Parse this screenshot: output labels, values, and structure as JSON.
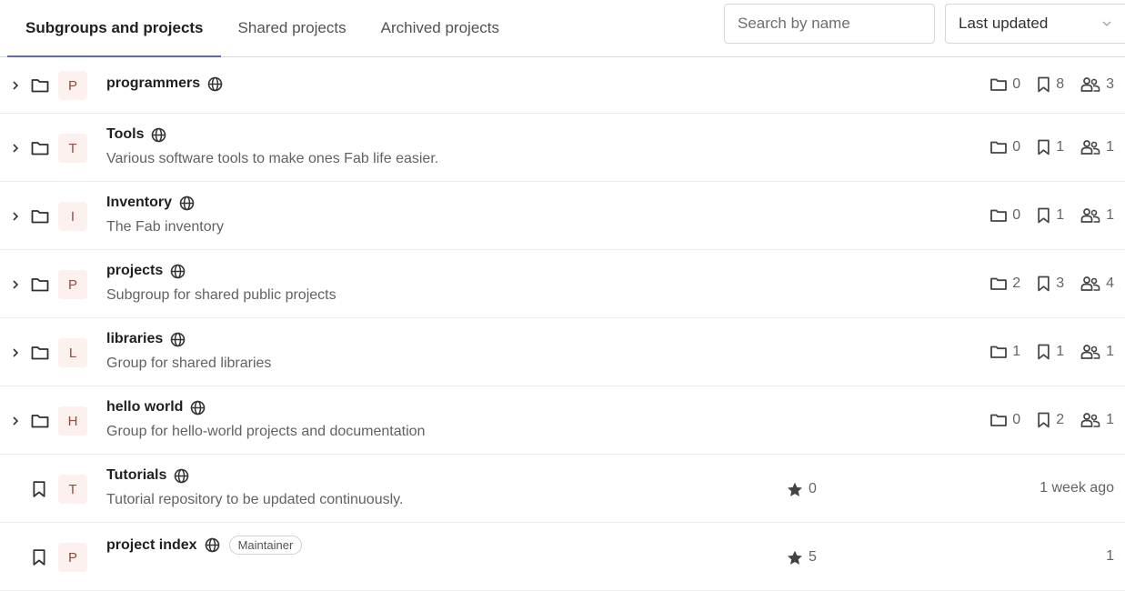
{
  "tabs": [
    {
      "label": "Subgroups and projects",
      "active": true
    },
    {
      "label": "Shared projects",
      "active": false
    },
    {
      "label": "Archived projects",
      "active": false
    }
  ],
  "search": {
    "placeholder": "Search by name"
  },
  "sort": {
    "selected": "Last updated"
  },
  "groups": [
    {
      "avatar": "P",
      "name": "programmers",
      "description": "",
      "subgroups": "0",
      "projects": "8",
      "members": "3"
    },
    {
      "avatar": "T",
      "name": "Tools",
      "description": "Various software tools to make ones Fab life easier.",
      "subgroups": "0",
      "projects": "1",
      "members": "1"
    },
    {
      "avatar": "I",
      "name": "Inventory",
      "description": "The Fab inventory",
      "subgroups": "0",
      "projects": "1",
      "members": "1"
    },
    {
      "avatar": "P",
      "name": "projects",
      "description": "Subgroup for shared public projects",
      "subgroups": "2",
      "projects": "3",
      "members": "4"
    },
    {
      "avatar": "L",
      "name": "libraries",
      "description": "Group for shared libraries",
      "subgroups": "1",
      "projects": "1",
      "members": "1"
    },
    {
      "avatar": "H",
      "name": "hello world",
      "description": "Group for hello-world projects and documentation",
      "subgroups": "0",
      "projects": "2",
      "members": "1"
    }
  ],
  "projects": [
    {
      "avatar": "T",
      "name": "Tutorials",
      "description": "Tutorial repository to be updated continuously.",
      "stars": "0",
      "updated": "1 week ago",
      "badge": ""
    },
    {
      "avatar": "P",
      "name": "project index",
      "description": "",
      "stars": "5",
      "updated": "1",
      "badge": "Maintainer"
    }
  ],
  "icons": {
    "caret": "chevron-right-icon",
    "folder": "folder-icon",
    "bookmark": "bookmark-icon",
    "members": "users-icon",
    "visibility": "globe-icon",
    "star": "star-icon"
  },
  "colors": {
    "accent": "#6666c4",
    "avatar_bg": "#fcf1ef",
    "avatar_fg": "#8d4d3f"
  }
}
